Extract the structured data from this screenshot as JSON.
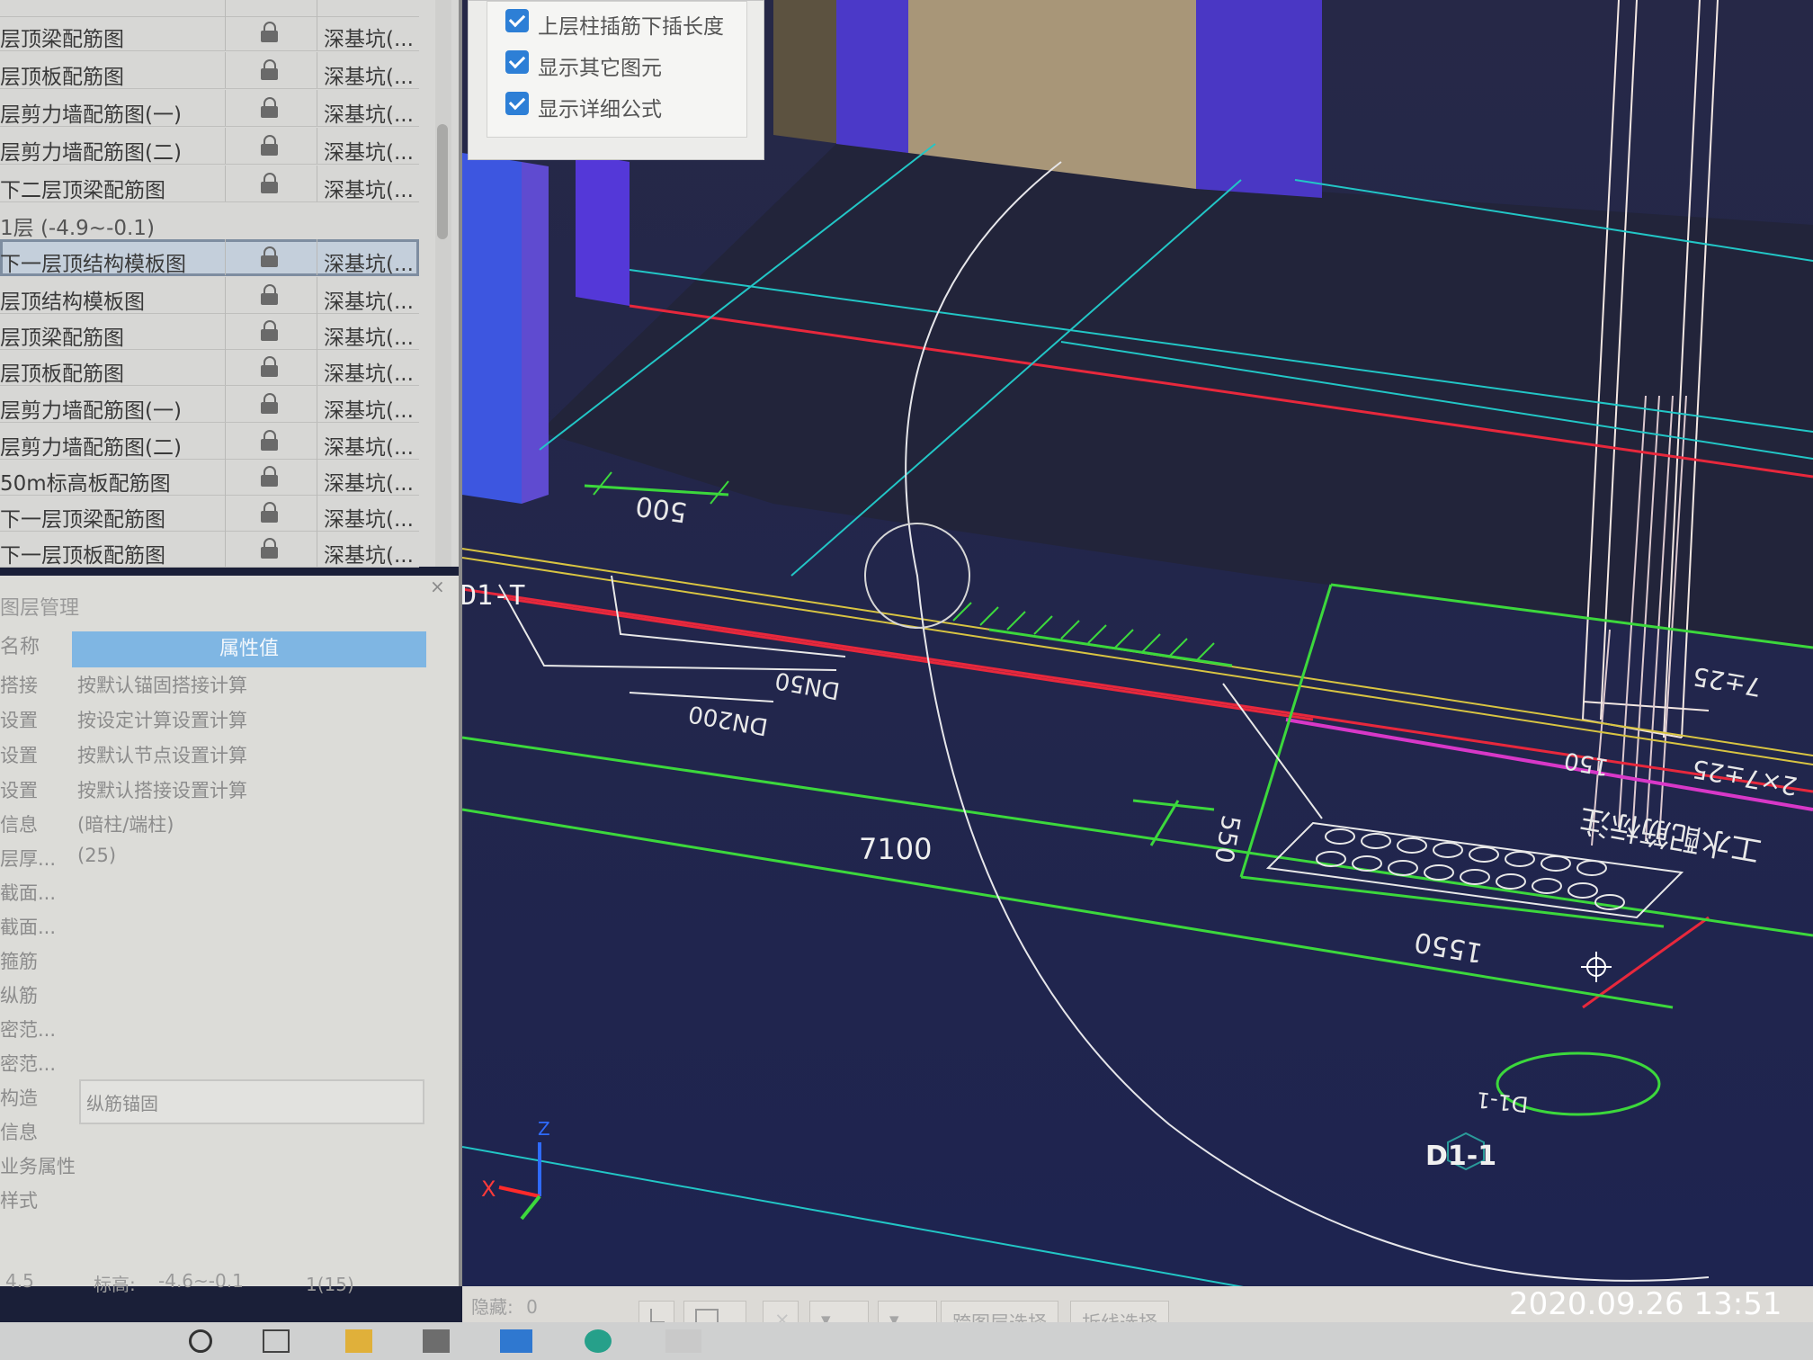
{
  "drawing_list": {
    "rows": [
      {
        "name": "层顶梁配筋图",
        "category": "深基坑(..."
      },
      {
        "name": "层顶板配筋图",
        "category": "深基坑(..."
      },
      {
        "name": "层剪力墙配筋图(一)",
        "category": "深基坑(..."
      },
      {
        "name": "层剪力墙配筋图(二)",
        "category": "深基坑(..."
      },
      {
        "name": "下二层顶梁配筋图",
        "category": "深基坑(..."
      },
      {
        "name": "1层 (-4.9~-0.1)",
        "category": ""
      },
      {
        "name": "下一层顶结构模板图",
        "category": "深基坑(..."
      },
      {
        "name": "层顶结构模板图",
        "category": "深基坑(..."
      },
      {
        "name": "层顶梁配筋图",
        "category": "深基坑(..."
      },
      {
        "name": "层顶板配筋图",
        "category": "深基坑(..."
      },
      {
        "name": "层剪力墙配筋图(一)",
        "category": "深基坑(..."
      },
      {
        "name": "层剪力墙配筋图(二)",
        "category": "深基坑(..."
      },
      {
        "name": "50m标高板配筋图",
        "category": "深基坑(..."
      },
      {
        "name": "下一层顶梁配筋图",
        "category": "深基坑(..."
      },
      {
        "name": "下一层顶板配筋图",
        "category": "深基坑(..."
      }
    ]
  },
  "layer_panel": {
    "title": "图层管理",
    "close": "×",
    "header_name": "名称",
    "header_value": "属性值",
    "rows": [
      {
        "name": "搭接",
        "value": "按默认锚固搭接计算"
      },
      {
        "name": "设置",
        "value": "按设定计算设置计算"
      },
      {
        "name": "设置",
        "value": "按默认节点设置计算"
      },
      {
        "name": "设置",
        "value": "按默认搭接设置计算"
      },
      {
        "name": "信息",
        "value": "(暗柱/端柱)"
      },
      {
        "name": "层厚...",
        "value": "(25)"
      },
      {
        "name": "截面...",
        "value": ""
      },
      {
        "name": "截面...",
        "value": ""
      },
      {
        "name": "箍筋",
        "value": ""
      },
      {
        "name": "纵筋",
        "value": ""
      },
      {
        "name": "密范...",
        "value": ""
      },
      {
        "name": "密范...",
        "value": ""
      },
      {
        "name": "构造",
        "value": ""
      },
      {
        "name": "信息",
        "value": ""
      },
      {
        "name": "业务属性",
        "value": ""
      },
      {
        "name": "样式",
        "value": ""
      }
    ],
    "input_value": "纵筋锚固"
  },
  "status_bar": {
    "left_value": "4.5",
    "elevation_label": "标高:",
    "elevation_value": "-4.6~-0.1",
    "page": "1(15)"
  },
  "options_panel": {
    "items": [
      {
        "label": "上层柱插筋下插长度",
        "checked": true
      },
      {
        "label": "显示其它图元",
        "checked": true
      },
      {
        "label": "显示详细公式",
        "checked": true
      }
    ]
  },
  "viewport": {
    "labels": {
      "d1t": "D1-T",
      "d1_1": "D1-1",
      "d1_1_circle": "D1-1",
      "dim_500": "500",
      "dim_7100": "7100",
      "dim_1550": "1550",
      "dim_550": "550",
      "dn50": "DN50",
      "dn200": "DN200",
      "rebar_1": "2×7±25",
      "rebar_2": "7±25",
      "rebar_3": "150",
      "rebar_4": "2×7±25 150",
      "mirror_text": "工水配筋标注",
      "axis_x": "X",
      "axis_z": "Z"
    }
  },
  "bottom_toolbar": {
    "hidden_label": "隐藏:",
    "hidden_value": "0",
    "layer_select": "跨图层选择",
    "polyline_select": "折线选择"
  },
  "photo_timestamp": "2020.09.26 13:51",
  "colors": {
    "viewport_bg": "#1a1f38",
    "purple_column": "#5a3de0",
    "red_line": "#e8283c",
    "green_line": "#3cd83c",
    "cyan_line": "#22c6c6",
    "yellow_line": "#d8c442",
    "selection_blue": "#7fb6e3"
  }
}
